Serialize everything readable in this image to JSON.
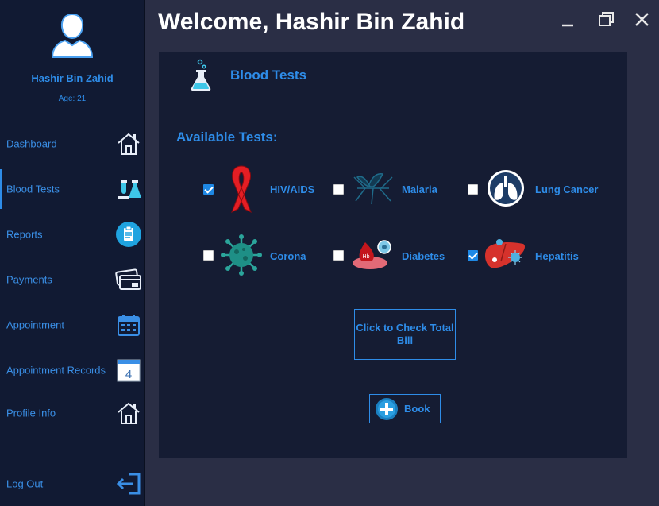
{
  "window": {
    "welcome_title": "Welcome, Hashir Bin Zahid",
    "minimize_icon": "minimize-icon",
    "restore_icon": "restore-icon",
    "close_icon": "close-icon"
  },
  "user": {
    "name": "Hashir Bin Zahid",
    "age_label": "Age: 21",
    "avatar_icon": "user-avatar-icon"
  },
  "sidebar": {
    "items": [
      {
        "label": "Dashboard",
        "icon": "home-icon",
        "active": false
      },
      {
        "label": "Blood Tests",
        "icon": "lab-flask-icon",
        "active": true
      },
      {
        "label": "Reports",
        "icon": "clipboard-icon",
        "active": false
      },
      {
        "label": "Payments",
        "icon": "payment-cards-icon",
        "active": false
      },
      {
        "label": "Appointment",
        "icon": "calendar-icon",
        "active": false
      },
      {
        "label": "Appointment Records",
        "icon": "calendar-day-icon",
        "calendar_day": "4",
        "active": false
      },
      {
        "label": "Profile Info",
        "icon": "home-icon",
        "active": false
      },
      {
        "label": "Log Out",
        "icon": "logout-icon",
        "active": false
      }
    ]
  },
  "main": {
    "title": "Blood Tests",
    "section_label": "Available Tests:",
    "tests": [
      {
        "name": "HIV/AIDS",
        "icon": "red-ribbon-icon",
        "checked": true
      },
      {
        "name": "Malaria",
        "icon": "mosquito-icon",
        "checked": false
      },
      {
        "name": "Lung Cancer",
        "icon": "lungs-icon",
        "checked": false
      },
      {
        "name": "Corona",
        "icon": "virus-icon",
        "checked": false
      },
      {
        "name": "Diabetes",
        "icon": "blood-drop-icon",
        "checked": false
      },
      {
        "name": "Hepatitis",
        "icon": "liver-icon",
        "checked": true
      }
    ],
    "bill_button": "Click to Check Total Bill",
    "book_button": "Book"
  },
  "colors": {
    "accent": "#2e8ce8",
    "sidebar_bg": "#111a33",
    "panel_bg": "#151c33",
    "window_bg": "#2a2e45"
  }
}
